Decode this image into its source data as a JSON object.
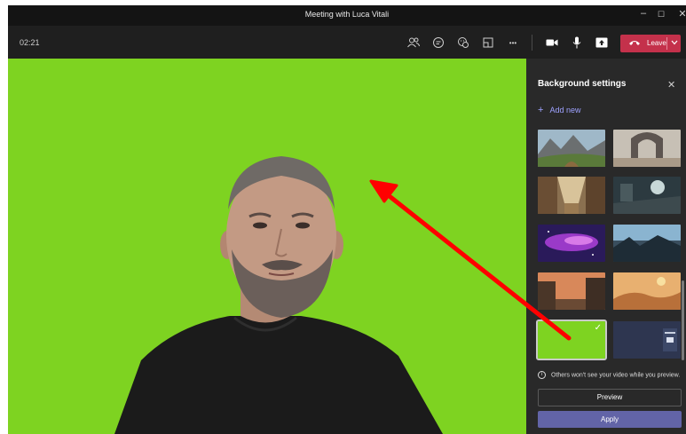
{
  "window": {
    "title": "Meeting with Luca Vitali",
    "minimize_glyph": "–",
    "maximize_glyph": "☐",
    "close_glyph": "✕"
  },
  "toolbar": {
    "timer": "02:21",
    "icons": [
      "participants-icon",
      "chat-icon",
      "reactions-icon",
      "rooms-icon",
      "more-icon",
      "camera-icon",
      "microphone-icon",
      "share-icon"
    ],
    "more_glyph": "•••",
    "leave_label": "Leave",
    "leave_color": "#c4314b"
  },
  "panel": {
    "title": "Background settings",
    "close_glyph": "✕",
    "add_new_label": "Add new",
    "add_new_plus": "+",
    "selected_check": "✓",
    "thumbnails": [
      "mountain-valley",
      "stone-arch",
      "fantasy-street",
      "scifi-ship",
      "purple-nebula",
      "alien-planet",
      "town-sunset",
      "desert-landscape",
      "green-solid",
      "calendar-poster"
    ],
    "selected_index": 8,
    "selected_color": "#7ed321",
    "note": "Others won't see your video while you preview.",
    "info_glyph": "i",
    "preview_label": "Preview",
    "apply_label": "Apply",
    "apply_color": "#6264a7"
  },
  "video": {
    "background_color": "#7ed321"
  },
  "annotation": {
    "arrow_color": "#ff0000"
  }
}
